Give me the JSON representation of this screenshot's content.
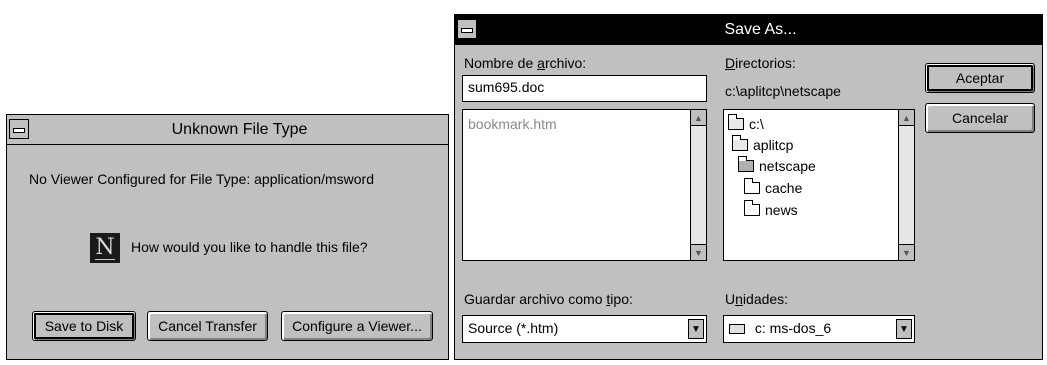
{
  "unknown_dialog": {
    "title": "Unknown File Type",
    "message": "No Viewer Configured for File Type:  application/msword",
    "question": "How would you like to handle this file?",
    "logo_letter": "N",
    "buttons": {
      "save": "Save to Disk",
      "cancel": "Cancel Transfer",
      "configure": "Configure a Viewer..."
    }
  },
  "save_as": {
    "title": "Save As...",
    "filename_label_pre": "Nombre de ",
    "filename_label_u": "a",
    "filename_label_post": "rchivo:",
    "filename_value": "sum695.doc",
    "file_list": [
      "bookmark.htm"
    ],
    "directories_label_u": "D",
    "directories_label_post": "irectorios:",
    "current_path": "c:\\aplitcp\\netscape",
    "directories": [
      {
        "name": "c:\\",
        "icon": "open-folder"
      },
      {
        "name": "aplitcp",
        "icon": "open-folder"
      },
      {
        "name": "netscape",
        "icon": "open-folder-selected"
      },
      {
        "name": "cache",
        "icon": "folder"
      },
      {
        "name": "news",
        "icon": "folder"
      }
    ],
    "type_label_pre": "Guardar archivo como ",
    "type_label_u": "t",
    "type_label_post": "ipo:",
    "type_value": "Source (*.htm)",
    "drives_label_pre": "U",
    "drives_label_u": "n",
    "drives_label_post": "idades:",
    "drive_value": "c: ms-dos_6",
    "ok_button": "Aceptar",
    "cancel_button": "Cancelar"
  }
}
